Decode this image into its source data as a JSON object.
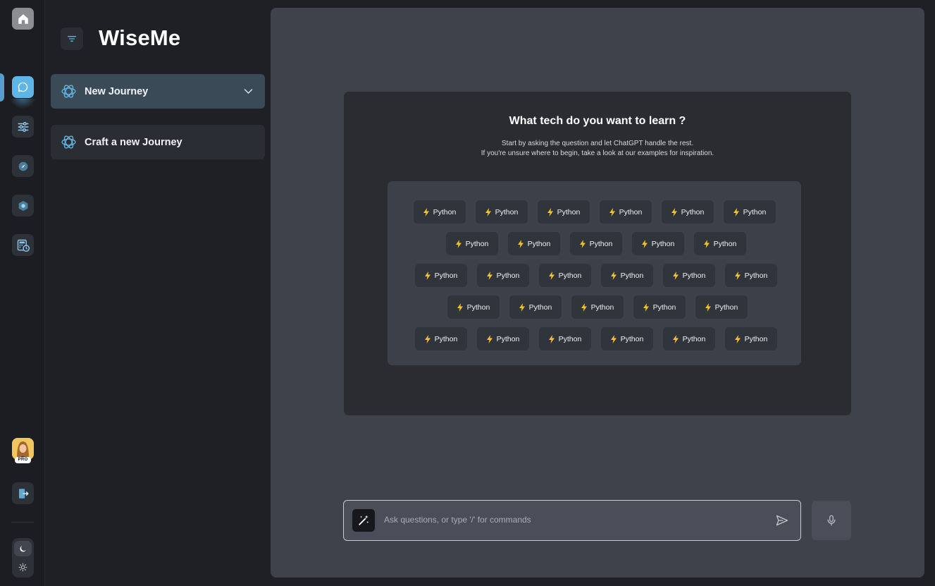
{
  "app": {
    "brand": "WiseMe"
  },
  "rail": {
    "items": [
      {
        "name": "home",
        "icon": "home-icon"
      },
      {
        "name": "chat",
        "icon": "chat-bubble-icon",
        "active": true
      },
      {
        "name": "tune",
        "icon": "sliders-icon"
      },
      {
        "name": "explore",
        "icon": "compass-icon"
      },
      {
        "name": "integrations",
        "icon": "hexagon-icon"
      },
      {
        "name": "schedule",
        "icon": "calculator-clock-icon"
      }
    ],
    "profile_badge": "PRO",
    "accent_color": "#5fb5e6"
  },
  "sidebar": {
    "journeys": [
      {
        "label": "New Journey",
        "icon": "openai-logo-icon",
        "expanded": false
      },
      {
        "label": "Craft a new Journey",
        "icon": "openai-logo-icon"
      }
    ]
  },
  "main": {
    "title": "What tech do you want to learn ?",
    "subtitle_line1": "Start by asking the question and let ChatGPT handle the rest.",
    "subtitle_line2": "If you're unsure where to begin, take a look at our examples for inspiration.",
    "chip_rows": [
      [
        "Python",
        "Python",
        "Python",
        "Python",
        "Python",
        "Python"
      ],
      [
        "Python",
        "Python",
        "Python",
        "Python",
        "Python"
      ],
      [
        "Python",
        "Python",
        "Python",
        "Python",
        "Python",
        "Python"
      ],
      [
        "Python",
        "Python",
        "Python",
        "Python",
        "Python"
      ],
      [
        "Python",
        "Python",
        "Python",
        "Python",
        "Python",
        "Python"
      ]
    ],
    "chip_icon": "lightning-bolt-icon"
  },
  "composer": {
    "placeholder": "Ask questions, or type '/' for commands",
    "value": ""
  }
}
